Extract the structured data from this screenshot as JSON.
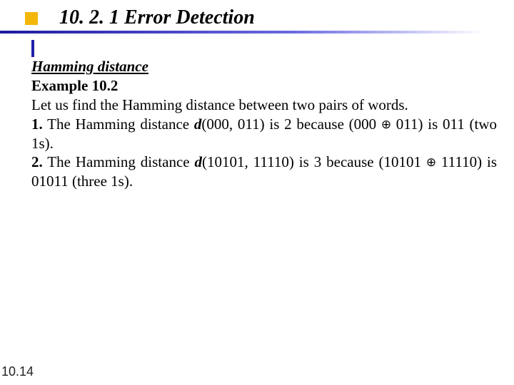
{
  "heading": "10. 2. 1 Error Detection",
  "body": {
    "subhead": "Hamming distance",
    "example_label": "Example 10.2",
    "intro": "Let us find the Hamming distance between two pairs of words.",
    "item1_num": "1.",
    "item1_a": " The Hamming distance ",
    "item1_func": "d",
    "item1_b": "(000, 011) is 2 because (000 ",
    "oplus": "⊕",
    "item1_c": " 011) is 011 (two 1s).",
    "item2_num": "2.",
    "item2_a": " The Hamming distance ",
    "item2_func": "d",
    "item2_b": "(10101, 11110) is 3 because (10101 ",
    "item2_c": " 11110) is 01011 (three 1s)."
  },
  "page_number": "10.14"
}
